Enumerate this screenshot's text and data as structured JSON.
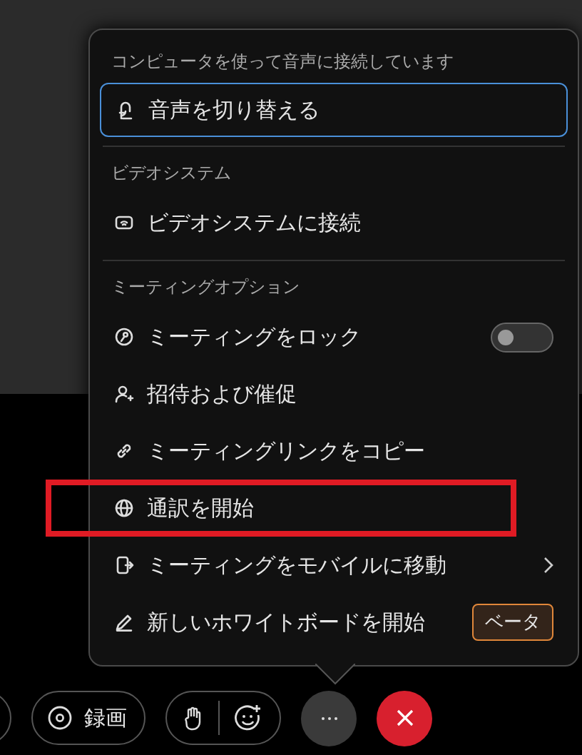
{
  "menu": {
    "sections": [
      {
        "header": "コンピュータを使って音声に接続しています",
        "items": [
          {
            "kind": "button",
            "label": "音声を切り替える",
            "focused": true,
            "annotated": false
          }
        ]
      },
      {
        "header": "ビデオシステム",
        "items": [
          {
            "kind": "plain",
            "label": "ビデオシステムに接続",
            "annotated": false
          }
        ]
      },
      {
        "header": "ミーティングオプション",
        "items": [
          {
            "kind": "toggle",
            "label": "ミーティングをロック",
            "on": false,
            "annotated": false
          },
          {
            "kind": "plain",
            "label": "招待および催促",
            "annotated": false
          },
          {
            "kind": "plain",
            "label": "ミーティングリンクをコピー",
            "annotated": false
          },
          {
            "kind": "plain",
            "label": "通訳を開始",
            "annotated": true
          },
          {
            "kind": "submenu",
            "label": "ミーティングをモバイルに移動",
            "annotated": false
          },
          {
            "kind": "badge",
            "label": "新しいホワイトボードを開始",
            "badge": "ベータ",
            "annotated": false
          }
        ]
      }
    ]
  },
  "toolbar": [
    {
      "kind": "partial"
    },
    {
      "kind": "record",
      "label": "録画"
    },
    {
      "kind": "reactions"
    },
    {
      "kind": "more"
    },
    {
      "kind": "end"
    }
  ]
}
